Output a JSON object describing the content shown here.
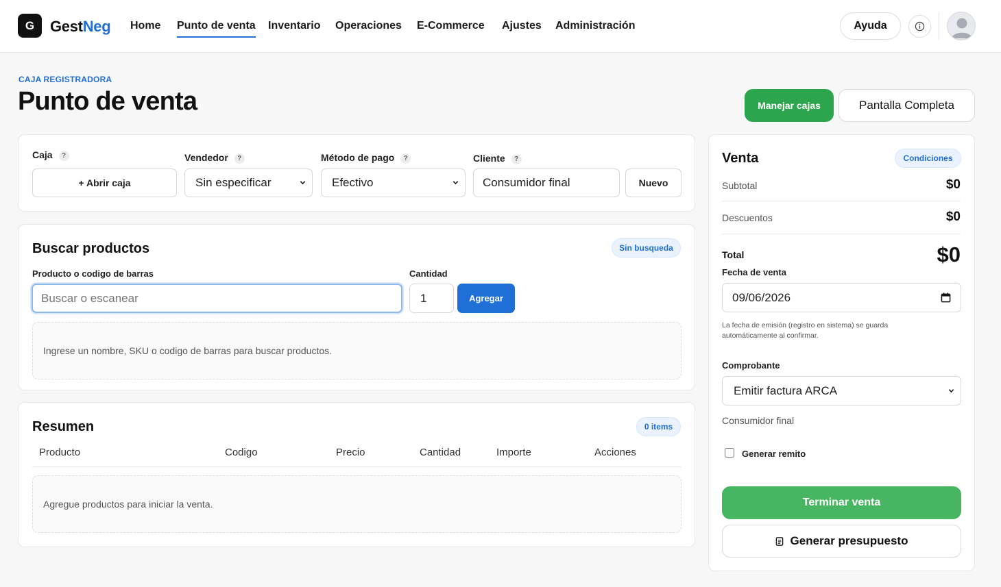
{
  "nav": {
    "logo_letter": "G",
    "brand_part1": "Gest",
    "brand_part2": "Neg",
    "items": [
      "Home",
      "Punto de venta",
      "Inventario",
      "Operaciones",
      "E-Commerce",
      "Ajustes",
      "Administración"
    ],
    "active_index": 1,
    "help_label": "Ayuda"
  },
  "header": {
    "eyebrow": "CAJA REGISTRADORA",
    "title": "Punto de venta",
    "manage_button": "Manejar cajas",
    "fullscreen_button": "Pantalla Completa"
  },
  "settings": {
    "caja_label": "Caja",
    "caja_button": "+ Abrir caja",
    "vendedor_label": "Vendedor",
    "vendedor_value": "Sin especificar",
    "metodo_label": "Método de pago",
    "metodo_value": "Efectivo",
    "cliente_label": "Cliente",
    "cliente_value": "Consumidor final",
    "nuevo_button": "Nuevo",
    "help_mark": "?"
  },
  "search": {
    "title": "Buscar productos",
    "badge": "Sin busqueda",
    "product_label": "Producto o codigo de barras",
    "product_placeholder": "Buscar o escanear",
    "qty_label": "Cantidad",
    "qty_value": "1",
    "add_button": "Agregar",
    "empty_text": "Ingrese un nombre, SKU o codigo de barras para buscar productos."
  },
  "summary": {
    "title": "Resumen",
    "badge": "0 items",
    "columns": [
      "Producto",
      "Codigo",
      "Precio",
      "Cantidad",
      "Importe",
      "Acciones"
    ],
    "empty_text": "Agregue productos para iniciar la venta."
  },
  "sale": {
    "title": "Venta",
    "conditions_badge": "Condiciones",
    "subtotal_label": "Subtotal",
    "subtotal_value": "$0",
    "discounts_label": "Descuentos",
    "discounts_value": "$0",
    "total_label": "Total",
    "total_value": "$0",
    "date_label": "Fecha de venta",
    "date_value": "09/06/2026",
    "date_note": "La fecha de emisión (registro en sistema) se guarda automáticamente al confirmar.",
    "voucher_label": "Comprobante",
    "voucher_value": "Emitir factura ARCA",
    "voucher_client": "Consumidor final",
    "remito_label": "Generar remito",
    "finish_button": "Terminar venta",
    "budget_button": "Generar presupuesto"
  },
  "colors": {
    "accent": "#1f6fd6",
    "success": "#2da44e"
  }
}
